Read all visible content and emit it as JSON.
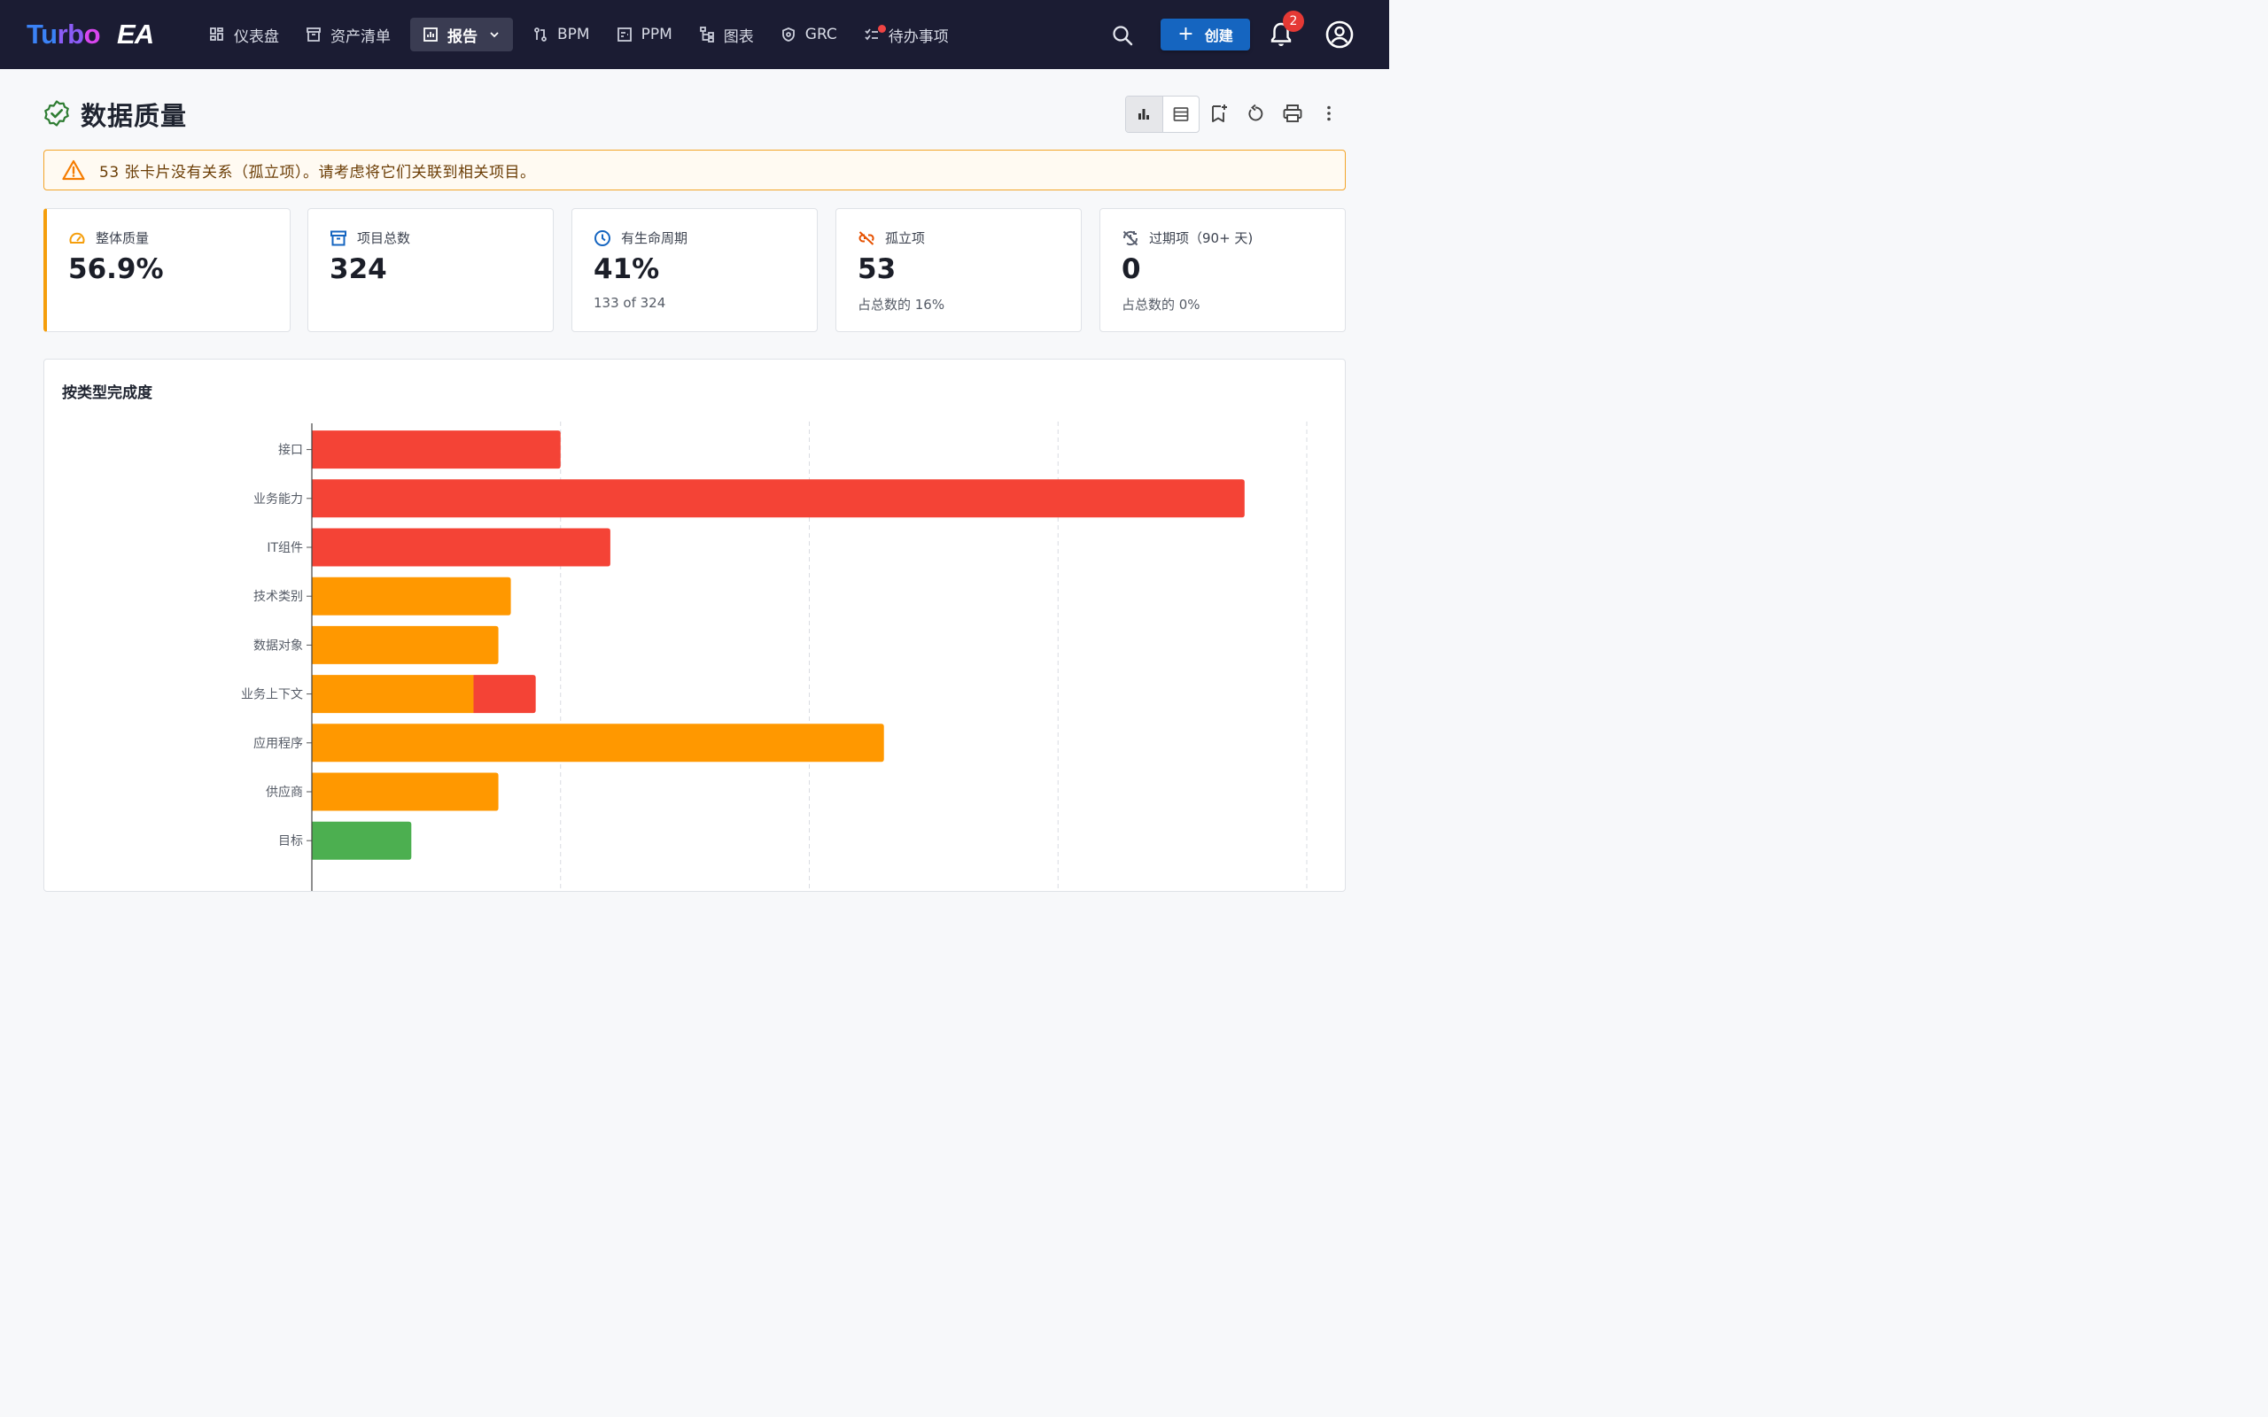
{
  "app": {
    "logo_turbo": "Turbo",
    "logo_ea": "EA"
  },
  "nav": {
    "items": [
      {
        "label": "仪表盘",
        "icon": "dashboard-icon"
      },
      {
        "label": "资产清单",
        "icon": "inventory-icon"
      },
      {
        "label": "报告",
        "icon": "report-icon",
        "active": true
      },
      {
        "label": "BPM",
        "icon": "bpm-icon"
      },
      {
        "label": "PPM",
        "icon": "ppm-icon"
      },
      {
        "label": "图表",
        "icon": "diagram-icon"
      },
      {
        "label": "GRC",
        "icon": "grc-icon"
      },
      {
        "label": "待办事项",
        "icon": "todo-icon"
      }
    ],
    "create_label": "创建",
    "notification_count": "2"
  },
  "page": {
    "title": "数据质量",
    "icon": "verified-icon"
  },
  "banner": {
    "text": "53 张卡片没有关系（孤立项）。请考虑将它们关联到相关项目。",
    "icon": "warning-icon",
    "color": "#f3a428"
  },
  "kpis": [
    {
      "label": "整体质量",
      "value": "56.9%",
      "sub": "",
      "icon": "speed-icon",
      "icon_color": "#f59e0b"
    },
    {
      "label": "项目总数",
      "value": "324",
      "sub": "",
      "icon": "archive-icon",
      "icon_color": "#1565c0"
    },
    {
      "label": "有生命周期",
      "value": "41%",
      "sub": "133 of 324",
      "icon": "clock-icon",
      "icon_color": "#1565c0"
    },
    {
      "label": "孤立项",
      "value": "53",
      "sub": "占总数的 16%",
      "icon": "link-off-icon",
      "icon_color": "#e65100"
    },
    {
      "label": "过期项（90+ 天)",
      "value": "0",
      "sub": "占总数的 0%",
      "icon": "update-disabled-icon",
      "icon_color": "#5a6070"
    }
  ],
  "panel": {
    "title": "按类型完成度"
  },
  "chart_data": {
    "type": "bar",
    "orientation": "horizontal",
    "stacked": true,
    "categories": [
      "接口",
      "业务能力",
      "IT组件",
      "技术类别",
      "数据对象",
      "业务上下文",
      "应用程序",
      "供应商",
      "目标"
    ],
    "series": [
      {
        "color": "#4caf50",
        "values": [
          0,
          0,
          0,
          0,
          0,
          0,
          0,
          0,
          8
        ]
      },
      {
        "color": "#ff9800",
        "values": [
          0,
          0,
          0,
          16,
          15,
          13,
          46,
          15,
          0
        ]
      },
      {
        "color": "#f44336",
        "values": [
          20,
          75,
          24,
          0,
          0,
          5,
          0,
          0,
          0
        ]
      }
    ],
    "xlim": [
      0,
      80
    ],
    "x_grid": [
      20,
      40,
      60,
      80
    ],
    "grid": true
  }
}
